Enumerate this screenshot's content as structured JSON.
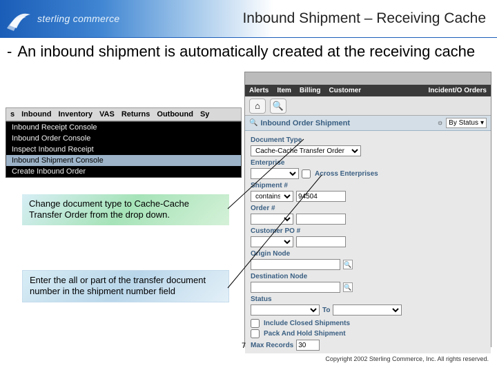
{
  "header": {
    "brand": "sterling commerce",
    "title": "Inbound Shipment – Receiving Cache"
  },
  "bullet": {
    "text": "An inbound shipment is automatically created at the receiving cache"
  },
  "menu": {
    "bar": [
      "s",
      "Inbound",
      "Inventory",
      "VAS",
      "Returns",
      "Outbound",
      "Sy"
    ],
    "items": [
      "Inbound Receipt Console",
      "Inbound Order Console",
      "Inspect Inbound Receipt",
      "Inbound Shipment Console",
      "Create Inbound Order"
    ],
    "highlight_index": 3
  },
  "instruction1": "Change document type to Cache-Cache Transfer Order from the drop down.",
  "instruction2": "Enter the all or part of the transfer document number in the shipment number field",
  "app": {
    "tabs": [
      "Alerts",
      "Item",
      "Billing",
      "Customer"
    ],
    "incident": "Incident/O Orders",
    "search_title": "Inbound Order Shipment",
    "by_status": "By Status",
    "labels": {
      "doc_type": "Document Type",
      "enterprise": "Enterprise",
      "across": "Across Enterprises",
      "shipment": "Shipment #",
      "order": "Order #",
      "po": "Customer PO #",
      "origin": "Origin Node",
      "dest": "Destination Node",
      "status": "Status",
      "to": "To",
      "include_closed": "Include Closed Shipments",
      "pack_hold": "Pack And Hold Shipment",
      "max": "Max Records"
    },
    "values": {
      "doc_type_sel": "Cache-Cache Transfer Order",
      "shipment_op": "contains",
      "shipment_val": "94504",
      "max_val": "30"
    }
  },
  "page_number": "7",
  "copyright": "Copyright 2002 Sterling Commerce, Inc. All rights reserved."
}
